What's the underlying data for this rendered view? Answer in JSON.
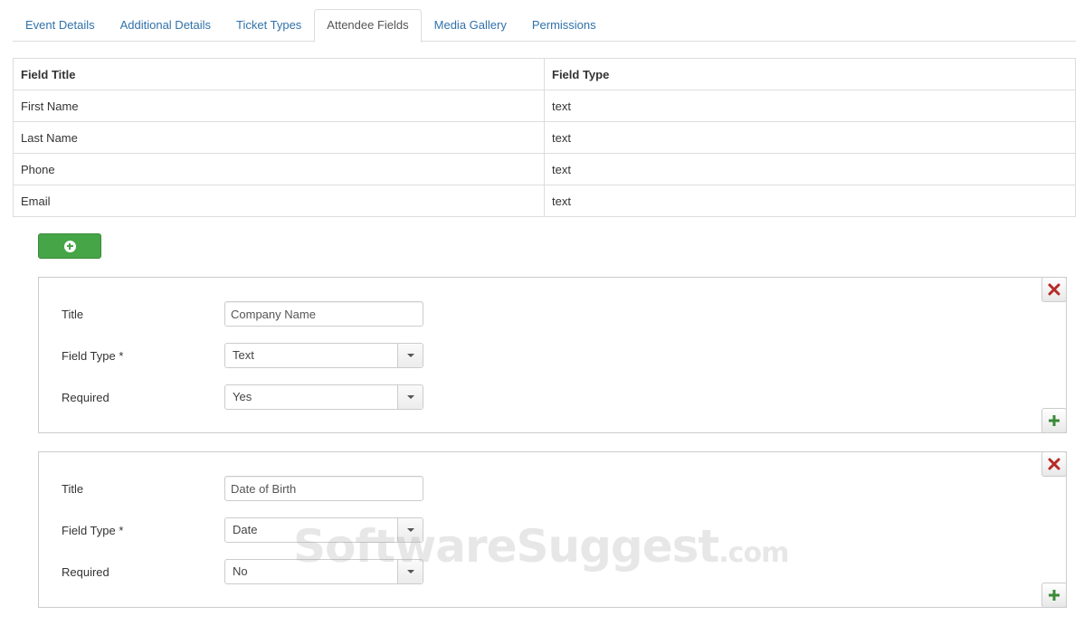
{
  "tabs": [
    {
      "label": "Event Details",
      "active": false
    },
    {
      "label": "Additional Details",
      "active": false
    },
    {
      "label": "Ticket Types",
      "active": false
    },
    {
      "label": "Attendee Fields",
      "active": true
    },
    {
      "label": "Media Gallery",
      "active": false
    },
    {
      "label": "Permissions",
      "active": false
    }
  ],
  "table": {
    "headers": [
      "Field Title",
      "Field Type"
    ],
    "rows": [
      [
        "First Name",
        "text"
      ],
      [
        "Last Name",
        "text"
      ],
      [
        "Phone",
        "text"
      ],
      [
        "Email",
        "text"
      ]
    ]
  },
  "add_button": {
    "icon": "plus-circle-icon",
    "color": "#46a546"
  },
  "field_panels": [
    {
      "title_label": "Title",
      "title_value": "Company Name",
      "type_label": "Field Type *",
      "type_value": "Text",
      "required_label": "Required",
      "required_value": "Yes"
    },
    {
      "title_label": "Title",
      "title_value": "Date of Birth",
      "type_label": "Field Type *",
      "type_value": "Date",
      "required_label": "Required",
      "required_value": "No"
    }
  ],
  "icons": {
    "remove": "close-icon",
    "add": "plus-icon",
    "remove_color": "#b52b27",
    "add_color": "#3a8a3a"
  },
  "watermark": {
    "main": "SoftwareSuggest",
    "tld": ".com"
  }
}
